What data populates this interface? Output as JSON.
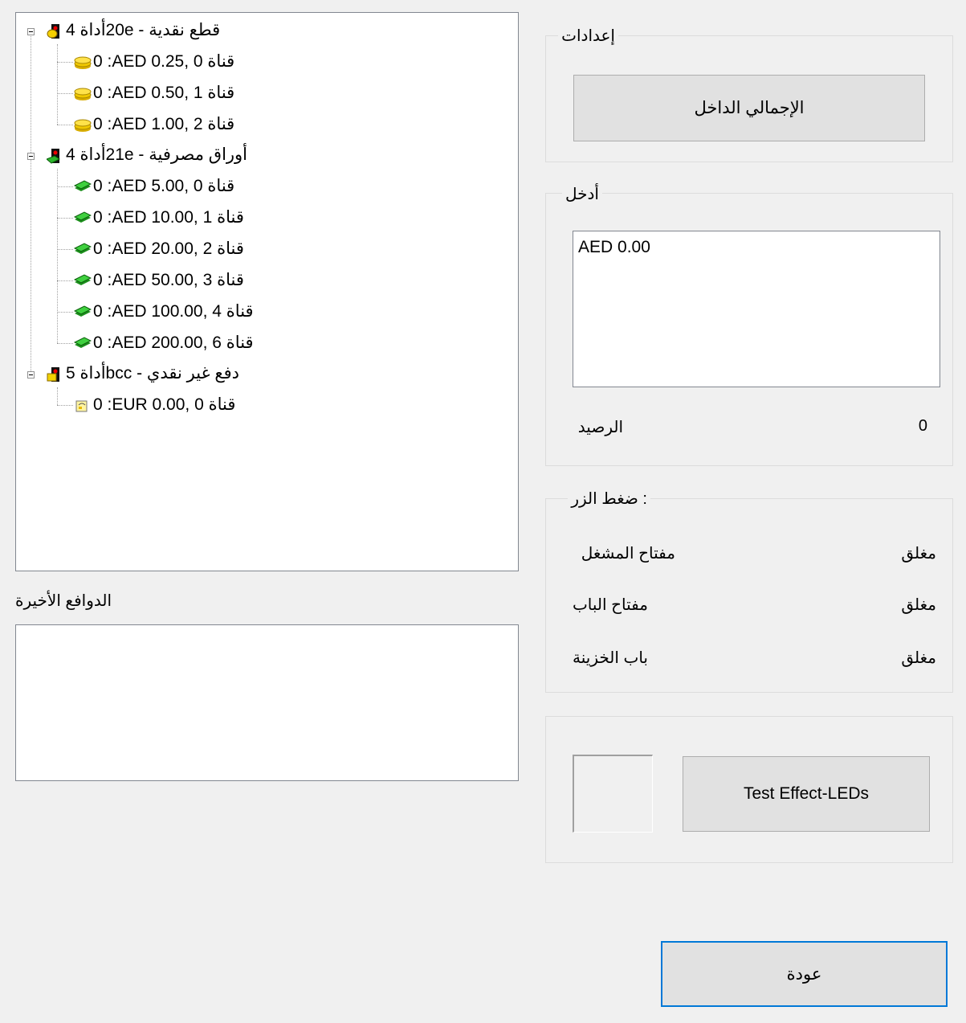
{
  "tree": {
    "groups": [
      {
        "label": "قطع نقدية - 20eأداة 4",
        "icon": "coin-device-icon",
        "children": [
          {
            "label": "0 :AED 0.25, قناة 0",
            "icon": "coin-icon"
          },
          {
            "label": "0 :AED 0.50, قناة 1",
            "icon": "coin-icon"
          },
          {
            "label": "0 :AED 1.00, قناة 2",
            "icon": "coin-icon"
          }
        ]
      },
      {
        "label": "أوراق مصرفية - 21eأداة 4",
        "icon": "banknote-device-icon",
        "children": [
          {
            "label": "0 :AED 5.00, قناة 0",
            "icon": "banknote-icon"
          },
          {
            "label": "0 :AED 10.00, قناة 1",
            "icon": "banknote-icon"
          },
          {
            "label": "0 :AED 20.00, قناة 2",
            "icon": "banknote-icon"
          },
          {
            "label": "0 :AED 50.00, قناة 3",
            "icon": "banknote-icon"
          },
          {
            "label": "0 :AED 100.00, قناة 4",
            "icon": "banknote-icon"
          },
          {
            "label": "0 :AED 200.00, قناة 6",
            "icon": "banknote-icon"
          }
        ]
      },
      {
        "label": "دفع غير نقدي - bccأداة 5",
        "icon": "cashless-device-icon",
        "children": [
          {
            "label": "0 :EUR 0.00, قناة 0",
            "icon": "card-icon"
          }
        ]
      }
    ]
  },
  "recent": {
    "title": "الدوافع الأخيرة"
  },
  "settings": {
    "title": "إعدادات",
    "total_button": "الإجمالي الداخل"
  },
  "input": {
    "title": "أدخل",
    "value": "AED 0.00",
    "balance_label": "الرصيد",
    "balance_value": "0"
  },
  "buttons_pressed": {
    "title": ": ضغط الزر",
    "rows": [
      {
        "label": "مفتاح المشغل",
        "state": "مغلق"
      },
      {
        "label": "مفتاح الباب",
        "state": "مغلق"
      },
      {
        "label": "باب الخزينة",
        "state": "مغلق"
      }
    ]
  },
  "leds": {
    "test_button": "Test Effect-LEDs"
  },
  "footer": {
    "back_button": "عودة"
  },
  "colors": {
    "window_bg": "#f0f0f0",
    "focus_border": "#0078d7"
  }
}
